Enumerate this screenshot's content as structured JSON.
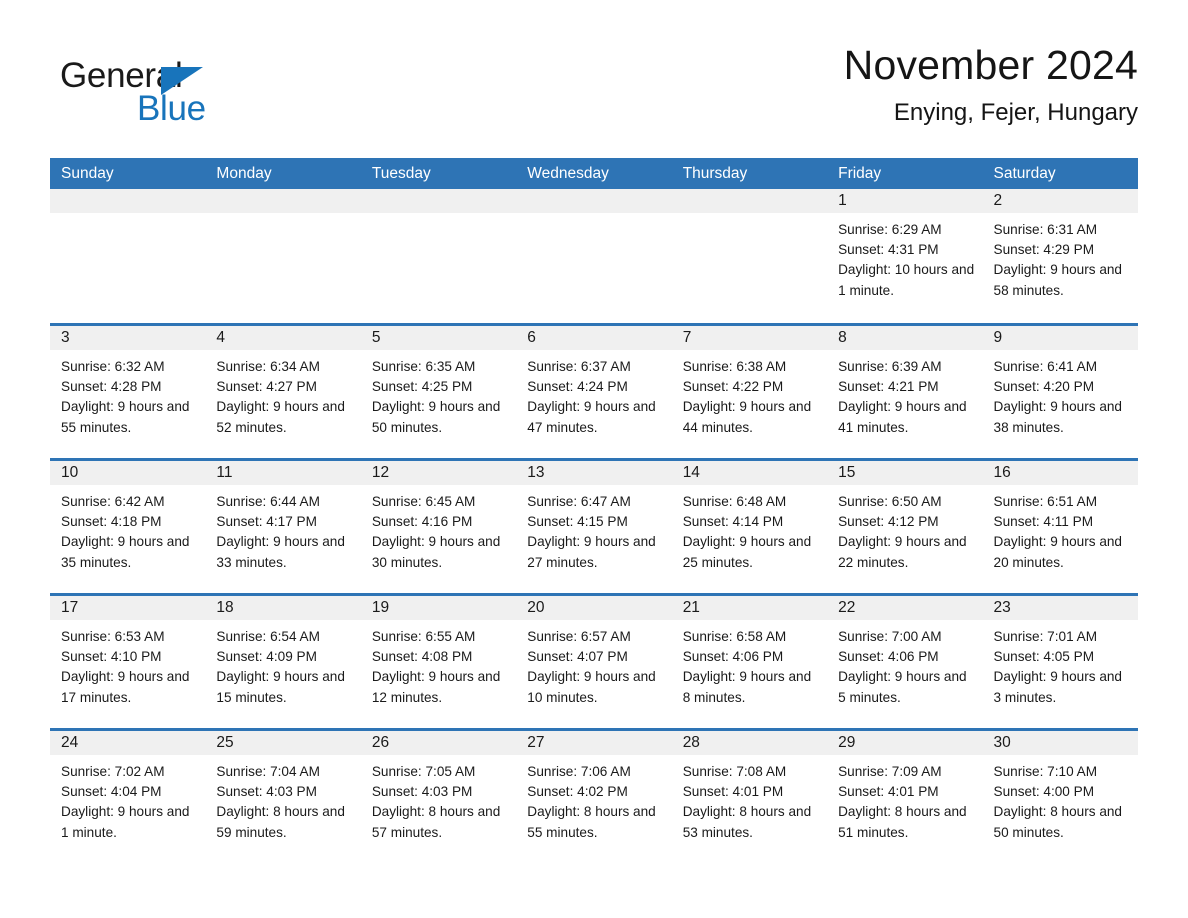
{
  "brand": {
    "name_part1": "General",
    "name_part2": "Blue",
    "triangle_color": "#1874bb",
    "text_color": "#1a1a1a"
  },
  "header": {
    "month_title": "November 2024",
    "location": "Enying, Fejer, Hungary",
    "header_bg_color": "#2e74b5",
    "header_text_color": "#ffffff",
    "day_strip_color": "#f0f0f0"
  },
  "weekday_headers": [
    "Sunday",
    "Monday",
    "Tuesday",
    "Wednesday",
    "Thursday",
    "Friday",
    "Saturday"
  ],
  "weeks": [
    [
      {
        "day": "",
        "sunrise": "",
        "sunset": "",
        "daylight": ""
      },
      {
        "day": "",
        "sunrise": "",
        "sunset": "",
        "daylight": ""
      },
      {
        "day": "",
        "sunrise": "",
        "sunset": "",
        "daylight": ""
      },
      {
        "day": "",
        "sunrise": "",
        "sunset": "",
        "daylight": ""
      },
      {
        "day": "",
        "sunrise": "",
        "sunset": "",
        "daylight": ""
      },
      {
        "day": "1",
        "sunrise": "Sunrise: 6:29 AM",
        "sunset": "Sunset: 4:31 PM",
        "daylight": "Daylight: 10 hours and 1 minute."
      },
      {
        "day": "2",
        "sunrise": "Sunrise: 6:31 AM",
        "sunset": "Sunset: 4:29 PM",
        "daylight": "Daylight: 9 hours and 58 minutes."
      }
    ],
    [
      {
        "day": "3",
        "sunrise": "Sunrise: 6:32 AM",
        "sunset": "Sunset: 4:28 PM",
        "daylight": "Daylight: 9 hours and 55 minutes."
      },
      {
        "day": "4",
        "sunrise": "Sunrise: 6:34 AM",
        "sunset": "Sunset: 4:27 PM",
        "daylight": "Daylight: 9 hours and 52 minutes."
      },
      {
        "day": "5",
        "sunrise": "Sunrise: 6:35 AM",
        "sunset": "Sunset: 4:25 PM",
        "daylight": "Daylight: 9 hours and 50 minutes."
      },
      {
        "day": "6",
        "sunrise": "Sunrise: 6:37 AM",
        "sunset": "Sunset: 4:24 PM",
        "daylight": "Daylight: 9 hours and 47 minutes."
      },
      {
        "day": "7",
        "sunrise": "Sunrise: 6:38 AM",
        "sunset": "Sunset: 4:22 PM",
        "daylight": "Daylight: 9 hours and 44 minutes."
      },
      {
        "day": "8",
        "sunrise": "Sunrise: 6:39 AM",
        "sunset": "Sunset: 4:21 PM",
        "daylight": "Daylight: 9 hours and 41 minutes."
      },
      {
        "day": "9",
        "sunrise": "Sunrise: 6:41 AM",
        "sunset": "Sunset: 4:20 PM",
        "daylight": "Daylight: 9 hours and 38 minutes."
      }
    ],
    [
      {
        "day": "10",
        "sunrise": "Sunrise: 6:42 AM",
        "sunset": "Sunset: 4:18 PM",
        "daylight": "Daylight: 9 hours and 35 minutes."
      },
      {
        "day": "11",
        "sunrise": "Sunrise: 6:44 AM",
        "sunset": "Sunset: 4:17 PM",
        "daylight": "Daylight: 9 hours and 33 minutes."
      },
      {
        "day": "12",
        "sunrise": "Sunrise: 6:45 AM",
        "sunset": "Sunset: 4:16 PM",
        "daylight": "Daylight: 9 hours and 30 minutes."
      },
      {
        "day": "13",
        "sunrise": "Sunrise: 6:47 AM",
        "sunset": "Sunset: 4:15 PM",
        "daylight": "Daylight: 9 hours and 27 minutes."
      },
      {
        "day": "14",
        "sunrise": "Sunrise: 6:48 AM",
        "sunset": "Sunset: 4:14 PM",
        "daylight": "Daylight: 9 hours and 25 minutes."
      },
      {
        "day": "15",
        "sunrise": "Sunrise: 6:50 AM",
        "sunset": "Sunset: 4:12 PM",
        "daylight": "Daylight: 9 hours and 22 minutes."
      },
      {
        "day": "16",
        "sunrise": "Sunrise: 6:51 AM",
        "sunset": "Sunset: 4:11 PM",
        "daylight": "Daylight: 9 hours and 20 minutes."
      }
    ],
    [
      {
        "day": "17",
        "sunrise": "Sunrise: 6:53 AM",
        "sunset": "Sunset: 4:10 PM",
        "daylight": "Daylight: 9 hours and 17 minutes."
      },
      {
        "day": "18",
        "sunrise": "Sunrise: 6:54 AM",
        "sunset": "Sunset: 4:09 PM",
        "daylight": "Daylight: 9 hours and 15 minutes."
      },
      {
        "day": "19",
        "sunrise": "Sunrise: 6:55 AM",
        "sunset": "Sunset: 4:08 PM",
        "daylight": "Daylight: 9 hours and 12 minutes."
      },
      {
        "day": "20",
        "sunrise": "Sunrise: 6:57 AM",
        "sunset": "Sunset: 4:07 PM",
        "daylight": "Daylight: 9 hours and 10 minutes."
      },
      {
        "day": "21",
        "sunrise": "Sunrise: 6:58 AM",
        "sunset": "Sunset: 4:06 PM",
        "daylight": "Daylight: 9 hours and 8 minutes."
      },
      {
        "day": "22",
        "sunrise": "Sunrise: 7:00 AM",
        "sunset": "Sunset: 4:06 PM",
        "daylight": "Daylight: 9 hours and 5 minutes."
      },
      {
        "day": "23",
        "sunrise": "Sunrise: 7:01 AM",
        "sunset": "Sunset: 4:05 PM",
        "daylight": "Daylight: 9 hours and 3 minutes."
      }
    ],
    [
      {
        "day": "24",
        "sunrise": "Sunrise: 7:02 AM",
        "sunset": "Sunset: 4:04 PM",
        "daylight": "Daylight: 9 hours and 1 minute."
      },
      {
        "day": "25",
        "sunrise": "Sunrise: 7:04 AM",
        "sunset": "Sunset: 4:03 PM",
        "daylight": "Daylight: 8 hours and 59 minutes."
      },
      {
        "day": "26",
        "sunrise": "Sunrise: 7:05 AM",
        "sunset": "Sunset: 4:03 PM",
        "daylight": "Daylight: 8 hours and 57 minutes."
      },
      {
        "day": "27",
        "sunrise": "Sunrise: 7:06 AM",
        "sunset": "Sunset: 4:02 PM",
        "daylight": "Daylight: 8 hours and 55 minutes."
      },
      {
        "day": "28",
        "sunrise": "Sunrise: 7:08 AM",
        "sunset": "Sunset: 4:01 PM",
        "daylight": "Daylight: 8 hours and 53 minutes."
      },
      {
        "day": "29",
        "sunrise": "Sunrise: 7:09 AM",
        "sunset": "Sunset: 4:01 PM",
        "daylight": "Daylight: 8 hours and 51 minutes."
      },
      {
        "day": "30",
        "sunrise": "Sunrise: 7:10 AM",
        "sunset": "Sunset: 4:00 PM",
        "daylight": "Daylight: 8 hours and 50 minutes."
      }
    ]
  ]
}
